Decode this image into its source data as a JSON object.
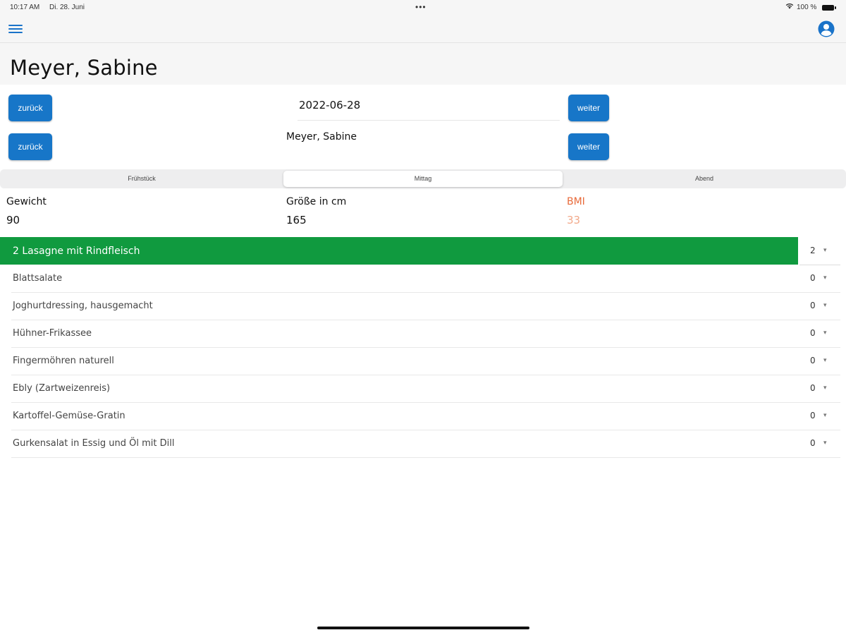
{
  "status_bar": {
    "time": "10:17 AM",
    "date": "Di. 28. Juni",
    "dots": "•••",
    "battery_text": "100 %"
  },
  "navbar": {
    "menu_icon": "hamburger-menu-icon",
    "profile_icon": "user-circle-icon",
    "accent_color": "#1a73c9"
  },
  "page": {
    "title": "Meyer, Sabine"
  },
  "date_nav": {
    "back_label": "zurück",
    "date_value": "2022-06-28",
    "next_label": "weiter"
  },
  "patient_nav": {
    "back_label": "zurück",
    "patient_name": "Meyer, Sabine",
    "next_label": "weiter"
  },
  "meal_tabs": [
    {
      "label": "Frühstück"
    },
    {
      "label": "Mittag"
    },
    {
      "label": "Abend"
    }
  ],
  "selected_tab": "Mittag",
  "stats": {
    "weight_label": "Gewicht",
    "weight_value": "90",
    "height_label": "Größe in cm",
    "height_value": "165",
    "bmi_label": "BMI",
    "bmi_value": "33"
  },
  "menu": {
    "header_item": {
      "label": "2 Lasagne mit Rindfleisch",
      "qty": "2"
    },
    "header_color": "#109a3f",
    "items": [
      {
        "label": "Blattsalate",
        "qty": "0"
      },
      {
        "label": "Joghurtdressing, hausgemacht",
        "qty": "0"
      },
      {
        "label": "Hühner-Frikassee",
        "qty": "0"
      },
      {
        "label": "Fingermöhren naturell",
        "qty": "0"
      },
      {
        "label": "Ebly (Zartweizenreis)",
        "qty": "0"
      },
      {
        "label": "Kartoffel-Gemüse-Gratin",
        "qty": "0"
      },
      {
        "label": "Gurkensalat in Essig und Öl mit Dill",
        "qty": "0"
      }
    ]
  },
  "button_color": "#1776c8"
}
